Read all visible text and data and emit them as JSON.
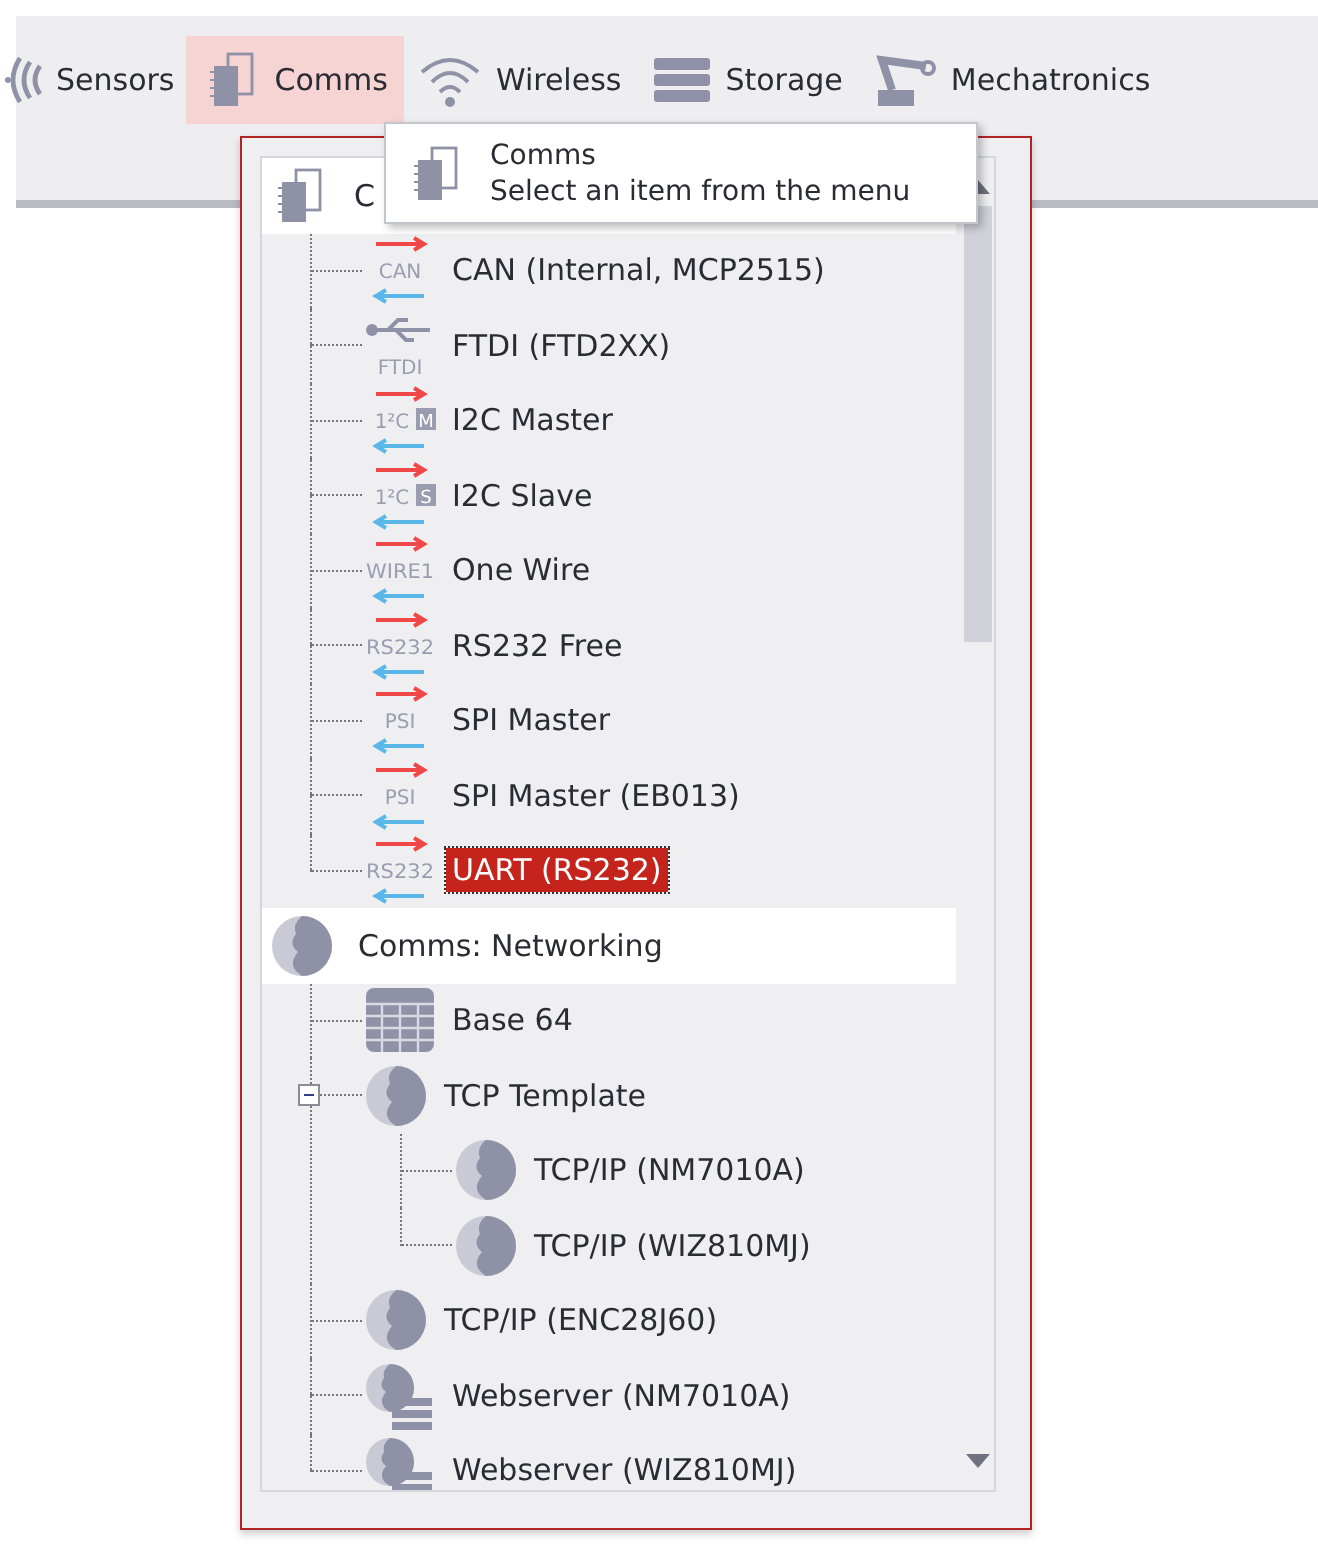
{
  "toolbar": [
    {
      "label": "Sensors",
      "kind": "sensors",
      "selected": false
    },
    {
      "label": "Comms",
      "kind": "chip",
      "selected": true
    },
    {
      "label": "Wireless",
      "kind": "wifi",
      "selected": false
    },
    {
      "label": "Storage",
      "kind": "storage",
      "selected": false
    },
    {
      "label": "Mechatronics",
      "kind": "robot-arm",
      "selected": false
    }
  ],
  "tooltip": {
    "title": "Comms",
    "text": "Select an item from the menu"
  },
  "menu": {
    "groups": [
      {
        "label": "C",
        "kind": "chip",
        "children": [
          {
            "label": "CAN (Internal, MCP2515)",
            "kind": "protocol",
            "icon_text": "CAN",
            "selected": false
          },
          {
            "label": "FTDI (FTD2XX)",
            "kind": "usb",
            "icon_text": "FTDI",
            "selected": false
          },
          {
            "label": "I2C Master",
            "kind": "protocol",
            "icon_text": "1²C",
            "icon_badge": "M",
            "selected": false
          },
          {
            "label": "I2C Slave",
            "kind": "protocol",
            "icon_text": "1²C",
            "icon_badge": "S",
            "selected": false
          },
          {
            "label": "One Wire",
            "kind": "protocol",
            "icon_text": "WIRE1",
            "selected": false
          },
          {
            "label": "RS232 Free",
            "kind": "protocol",
            "icon_text": "RS232",
            "selected": false
          },
          {
            "label": "SPI Master",
            "kind": "protocol",
            "icon_text": "PSI",
            "selected": false
          },
          {
            "label": "SPI Master (EB013)",
            "kind": "protocol",
            "icon_text": "PSI",
            "selected": false
          },
          {
            "label": "UART (RS232)",
            "kind": "protocol",
            "icon_text": "RS232",
            "selected": true
          }
        ]
      },
      {
        "label": "Comms: Networking",
        "kind": "globe",
        "children": [
          {
            "label": "Base 64",
            "kind": "grid",
            "selected": false
          },
          {
            "label": "TCP Template",
            "kind": "globe",
            "selected": false,
            "expanded": true,
            "children": [
              {
                "label": "TCP/IP (NM7010A)",
                "kind": "globe",
                "selected": false
              },
              {
                "label": "TCP/IP (WIZ810MJ)",
                "kind": "globe",
                "selected": false
              }
            ]
          },
          {
            "label": "TCP/IP (ENC28J60)",
            "kind": "globe",
            "selected": false
          },
          {
            "label": "Webserver (NM7010A)",
            "kind": "globe-server",
            "selected": false
          },
          {
            "label": "Webserver (WIZ810MJ)",
            "kind": "globe-server",
            "selected": false
          }
        ]
      }
    ]
  }
}
